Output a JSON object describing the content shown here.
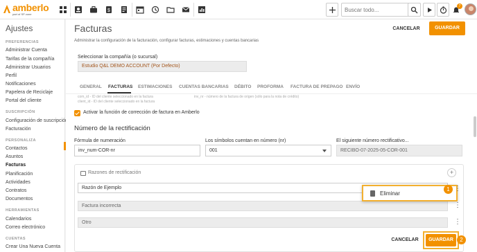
{
  "brand": {
    "logo_text": "amberlo",
    "logo_sub": "part of SP zone",
    "accent": "#f29100"
  },
  "topbar": {
    "search_placeholder": "Buscar todo...",
    "notification_count": "7",
    "icons": [
      "dashboard-icon",
      "contacts-icon",
      "briefcase-icon",
      "billing-icon",
      "documents-icon",
      "calendar-icon",
      "history-icon",
      "folder-icon",
      "mail-icon",
      "reports-icon"
    ]
  },
  "sidebar": {
    "title": "Ajustes",
    "sections": [
      {
        "name": "PREFERENCIAS",
        "items": [
          "Administrar Cuenta",
          "Tarifas de la compañía",
          "Administrar Usuarios",
          "Perfil",
          "Notificaciones",
          "Papelera de Reciclaje",
          "Portal del cliente"
        ]
      },
      {
        "name": "SUSCRIPCIÓN",
        "items": [
          "Configuración de suscripción",
          "Facturación"
        ]
      },
      {
        "name": "PERSONALIZA",
        "items": [
          "Contactos",
          "Asuntos",
          "Facturas",
          "Planificación",
          "Actividades",
          "Contratos",
          "Documentos"
        ]
      },
      {
        "name": "HERRAMIENTAS",
        "items": [
          "Calendarios",
          "Correo electrónico"
        ]
      },
      {
        "name": "CUENTAS",
        "items": [
          "Crear Una Nueva Cuenta"
        ]
      }
    ],
    "active_item": "Facturas"
  },
  "header": {
    "title": "Facturas",
    "subtitle": "Administrar la configuración de la facturación, configurar facturas, estimaciones y cuentas bancarias",
    "cancel_label": "CANCELAR",
    "save_label": "GUARDAR"
  },
  "company": {
    "label": "Seleccionar la compañía (o sucursal)",
    "value": "Estudio Q&L DEMO ACCOUNT (Por Defecto)"
  },
  "tabs": [
    "GENERAL",
    "FACTURAS",
    "ESTIMACIONES",
    "CUENTAS BANCARIAS",
    "DÉBITO",
    "PROFORMA",
    "FACTURA DE PREPAGO",
    "ENVÍO"
  ],
  "active_tab": "FACTURAS",
  "ghost_text": {
    "line1": "com_id - ID del cliente seleccionado en la factura",
    "line2": "client_id - ID del cliente seleccionado en la factura",
    "line3": "inv_nr - número de la factura de origen (sólo para la nota de crédito)"
  },
  "correction": {
    "checkbox_label": "Activar la función de corrección de factura en Amberlo",
    "section_title": "Número de la rectificación",
    "format_label": "Fórmula de numeración",
    "format_value": "inv_num-COR-nr",
    "digits_label": "Los símbolos cuentan en número (nr)",
    "digits_value": "001",
    "next_label": "El siguiente número rectificativo...",
    "next_value": "RECIBO-07-2025-05-COR-001"
  },
  "reasons": {
    "title": "Razones de rectificación",
    "items": [
      "Razón de Ejemplo",
      "Factura incorrecta",
      "Otro"
    ]
  },
  "context_menu": {
    "delete_label": "Eliminar"
  },
  "callouts": [
    "1",
    "2"
  ],
  "footer": {
    "cancel_label": "CANCELAR",
    "save_label": "GUARDAR"
  }
}
